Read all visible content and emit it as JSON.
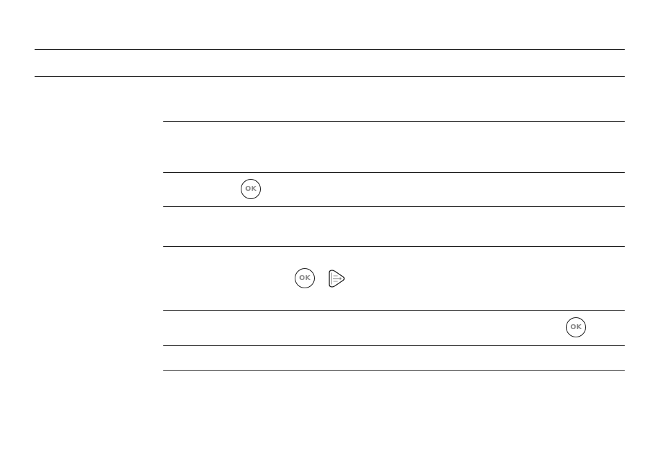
{
  "header": {
    "title": ""
  },
  "rows": [
    {
      "text": ""
    },
    {
      "text": "",
      "button": "OK"
    },
    {
      "text": ""
    },
    {
      "text": "",
      "buttons": [
        "OK",
        "navigate-right"
      ]
    },
    {
      "text": "",
      "button": "OK"
    },
    {
      "text": ""
    }
  ],
  "icons": {
    "ok_label": "OK",
    "nav_icon": "navigate-right-icon"
  },
  "colors": {
    "rule": "#1a1a1a",
    "icon_text": "#8a8a8a"
  }
}
